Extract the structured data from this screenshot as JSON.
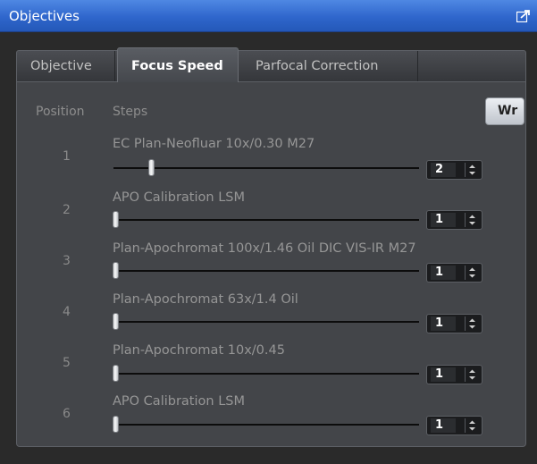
{
  "window": {
    "title": "Objectives"
  },
  "tabs": [
    {
      "label": "Objective"
    },
    {
      "label": "Focus Speed"
    },
    {
      "label": "Parfocal Correction"
    }
  ],
  "active_tab": "Focus Speed",
  "headers": {
    "position": "Position",
    "steps": "Steps"
  },
  "write_button": {
    "label": "Wr"
  },
  "rows": [
    {
      "position": "1",
      "name": "EC Plan-Neofluar 10x/0.30 M27",
      "steps": "2"
    },
    {
      "position": "2",
      "name": "APO Calibration LSM",
      "steps": "1"
    },
    {
      "position": "3",
      "name": "Plan-Apochromat 100x/1.46 Oil DIC VIS-IR M27",
      "steps": "1"
    },
    {
      "position": "4",
      "name": "Plan-Apochromat 63x/1.4 Oil",
      "steps": "1"
    },
    {
      "position": "5",
      "name": "Plan-Apochromat 10x/0.45",
      "steps": "1"
    },
    {
      "position": "6",
      "name": "APO Calibration LSM",
      "steps": "1"
    }
  ],
  "icons": {
    "undock": "undock-icon",
    "spinner": "spin-arrows-icon"
  },
  "colors": {
    "title_bar": "#2f66cc",
    "panel": "#434549",
    "tab_active": "#5a5d63"
  }
}
